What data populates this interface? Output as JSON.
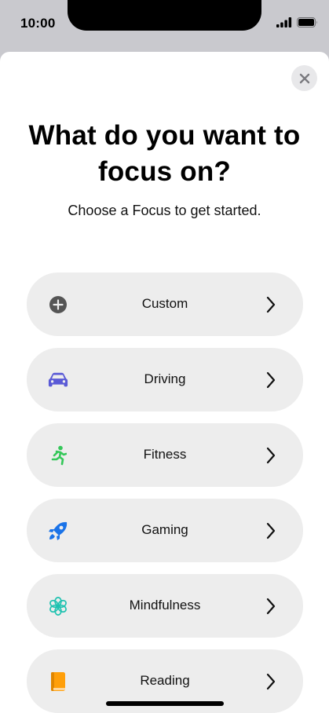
{
  "status_bar": {
    "time": "10:00",
    "icons": [
      "signal-icon",
      "battery-icon"
    ]
  },
  "sheet": {
    "close_icon": "close-icon",
    "title": "What do you want to focus on?",
    "subtitle": "Choose a Focus to get started."
  },
  "focus_options": [
    {
      "label": "Custom",
      "icon": "plus-circle-icon",
      "color": "#555555"
    },
    {
      "label": "Driving",
      "icon": "car-icon",
      "color": "#5a5ad6"
    },
    {
      "label": "Fitness",
      "icon": "running-person-icon",
      "color": "#34c759"
    },
    {
      "label": "Gaming",
      "icon": "rocket-icon",
      "color": "#1a73e8"
    },
    {
      "label": "Mindfulness",
      "icon": "flower-icon",
      "color": "#1ec2b0"
    },
    {
      "label": "Reading",
      "icon": "book-icon",
      "color": "#ff9f0a"
    }
  ]
}
